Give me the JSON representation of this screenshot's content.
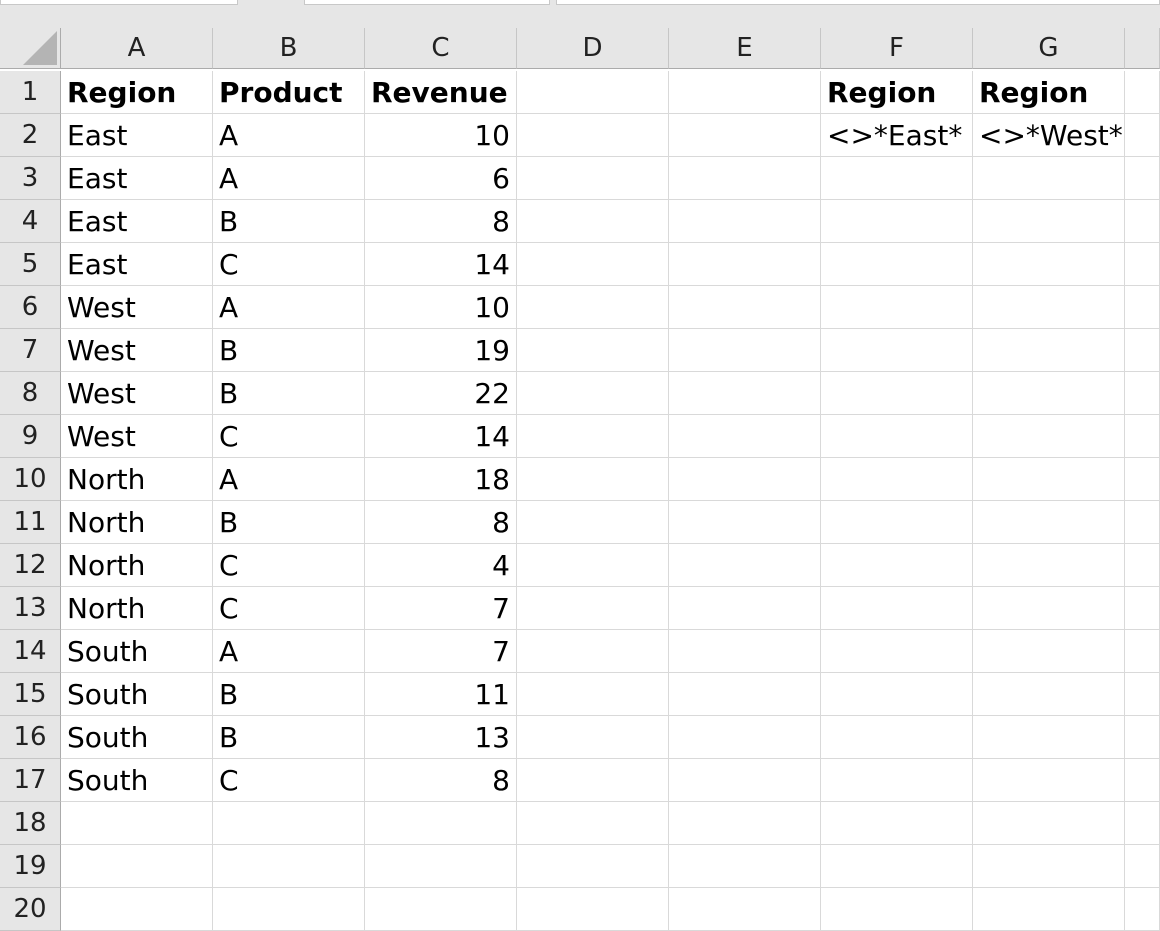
{
  "columns": [
    "A",
    "B",
    "C",
    "D",
    "E",
    "F",
    "G"
  ],
  "rows": [
    {
      "num": "1",
      "cells": [
        "Region",
        "Product",
        "Revenue",
        "",
        "",
        "Region",
        "Region"
      ]
    },
    {
      "num": "2",
      "cells": [
        "East",
        "A",
        "10",
        "",
        "",
        "<>*East*",
        "<>*West*"
      ]
    },
    {
      "num": "3",
      "cells": [
        "East",
        "A",
        "6",
        "",
        "",
        "",
        ""
      ]
    },
    {
      "num": "4",
      "cells": [
        "East",
        "B",
        "8",
        "",
        "",
        "",
        ""
      ]
    },
    {
      "num": "5",
      "cells": [
        "East",
        "C",
        "14",
        "",
        "",
        "",
        ""
      ]
    },
    {
      "num": "6",
      "cells": [
        "West",
        "A",
        "10",
        "",
        "",
        "",
        ""
      ]
    },
    {
      "num": "7",
      "cells": [
        "West",
        "B",
        "19",
        "",
        "",
        "",
        ""
      ]
    },
    {
      "num": "8",
      "cells": [
        "West",
        "B",
        "22",
        "",
        "",
        "",
        ""
      ]
    },
    {
      "num": "9",
      "cells": [
        "West",
        "C",
        "14",
        "",
        "",
        "",
        ""
      ]
    },
    {
      "num": "10",
      "cells": [
        "North",
        "A",
        "18",
        "",
        "",
        "",
        ""
      ]
    },
    {
      "num": "11",
      "cells": [
        "North",
        "B",
        "8",
        "",
        "",
        "",
        ""
      ]
    },
    {
      "num": "12",
      "cells": [
        "North",
        "C",
        "4",
        "",
        "",
        "",
        ""
      ]
    },
    {
      "num": "13",
      "cells": [
        "North",
        "C",
        "7",
        "",
        "",
        "",
        ""
      ]
    },
    {
      "num": "14",
      "cells": [
        "South",
        "A",
        "7",
        "",
        "",
        "",
        ""
      ]
    },
    {
      "num": "15",
      "cells": [
        "South",
        "B",
        "11",
        "",
        "",
        "",
        ""
      ]
    },
    {
      "num": "16",
      "cells": [
        "South",
        "B",
        "13",
        "",
        "",
        "",
        ""
      ]
    },
    {
      "num": "17",
      "cells": [
        "South",
        "C",
        "8",
        "",
        "",
        "",
        ""
      ]
    },
    {
      "num": "18",
      "cells": [
        "",
        "",
        "",
        "",
        "",
        "",
        ""
      ]
    },
    {
      "num": "19",
      "cells": [
        "",
        "",
        "",
        "",
        "",
        "",
        ""
      ]
    },
    {
      "num": "20",
      "cells": [
        "",
        "",
        "",
        "",
        "",
        "",
        ""
      ]
    }
  ]
}
